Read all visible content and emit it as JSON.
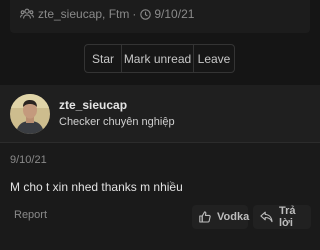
{
  "thread_meta": {
    "participants": "zte_sieucap, Ftm",
    "separator": "·",
    "date": "9/10/21",
    "icons": [
      "users-icon",
      "clock-icon"
    ]
  },
  "thread_actions": {
    "star": "Star",
    "mark_unread": "Mark unread",
    "leave": "Leave"
  },
  "post": {
    "username": "zte_sieucap",
    "user_title": "Checker chuyên nghiệp",
    "date": "9/10/21",
    "message": "M cho t xin nhed thanks m nhiều",
    "report_label": "Report",
    "like_label": "Vodka",
    "reply_label": "Trả lời",
    "icons": [
      "thumbs-up-icon",
      "reply-icon"
    ]
  },
  "colors": {
    "page_bg": "#151515",
    "card_bg": "#1a1a1a",
    "header_bg": "#1f1f1f",
    "muted_text": "#8a8a8a",
    "button_bg": "#212121"
  }
}
